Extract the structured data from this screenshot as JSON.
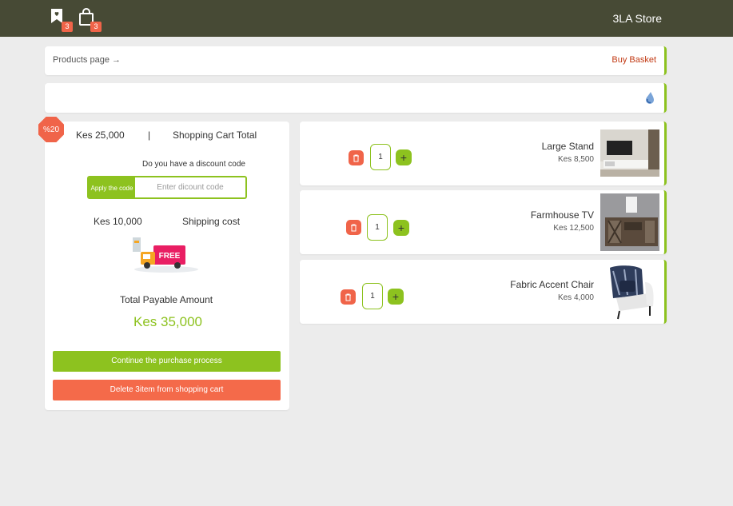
{
  "header": {
    "wishlist_icon": "bookmark-heart-icon",
    "wishlist_count": "3",
    "cart_icon": "shopping-bag-icon",
    "cart_count": "3",
    "store_name": "3LA Store"
  },
  "breadcrumb": {
    "left": "Products page →",
    "right": "Buy Basket"
  },
  "search_bar": {
    "icon": "water-drop-icon"
  },
  "summary": {
    "discount_badge": "%20",
    "cart_total_value": "Kes 25,000",
    "separator": "|",
    "cart_total_label": "Shopping Cart Total",
    "discount_question": "Do you have a discount code",
    "apply_label": "Apply the code",
    "code_placeholder": "Enter dicount code",
    "shipping_value": "Kes 10,000",
    "shipping_label": "Shipping cost",
    "free_label": "FREE",
    "total_label": "Total Payable Amount",
    "total_value": "Kes 35,000",
    "continue_button": "Continue the purchase process",
    "delete_button": "Delete 3item from shopping cart"
  },
  "items": [
    {
      "name": "Large Stand",
      "price": "Kes 8,500",
      "qty": "1",
      "plus": "+"
    },
    {
      "name": "Farmhouse TV",
      "price": "Kes 12,500",
      "qty": "1",
      "plus": "+"
    },
    {
      "name": "Fabric Accent Chair",
      "price": "Kes 4,000",
      "qty": "1",
      "plus": "+"
    }
  ],
  "colors": {
    "topbar": "#474a35",
    "accent_green": "#8dc21f",
    "accent_red": "#f06449",
    "link_red": "#c23a14"
  }
}
